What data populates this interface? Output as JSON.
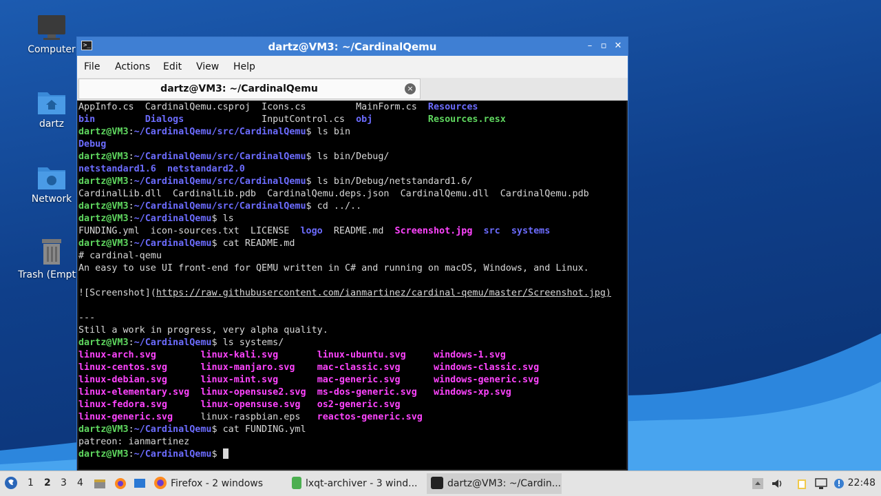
{
  "desktop": {
    "icons": [
      {
        "label": "Computer"
      },
      {
        "label": "dartz"
      },
      {
        "label": "Network"
      },
      {
        "label": "Trash (Empty)"
      }
    ]
  },
  "window": {
    "title": "dartz@VM3: ~/CardinalQemu",
    "controls": {
      "minimize": "–",
      "maximize": "▫",
      "close": "✕"
    },
    "menu": [
      "File",
      "Actions",
      "Edit",
      "View",
      "Help"
    ],
    "tab": {
      "label": "dartz@VM3: ~/CardinalQemu",
      "close": "×"
    }
  },
  "terminal": {
    "prompt_user": "dartz@VM3",
    "lines": [
      [
        {
          "t": "AppInfo.cs  CardinalQemu.csproj  Icons.cs         MainForm.cs  "
        },
        {
          "t": "Resources",
          "c": "d"
        }
      ],
      [
        {
          "t": "bin",
          "c": "d"
        },
        {
          "t": "         "
        },
        {
          "t": "Dialogs",
          "c": "d"
        },
        {
          "t": "              InputControl.cs  "
        },
        {
          "t": "obj",
          "c": "d"
        },
        {
          "t": "          "
        },
        {
          "t": "Resources.resx",
          "c": "g"
        }
      ],
      [
        {
          "t": "dartz@VM3",
          "c": "u"
        },
        {
          "t": ":"
        },
        {
          "t": "~/CardinalQemu/src/CardinalQemu",
          "c": "p"
        },
        {
          "t": "$ ls bin"
        }
      ],
      [
        {
          "t": "Debug",
          "c": "d"
        }
      ],
      [
        {
          "t": "dartz@VM3",
          "c": "u"
        },
        {
          "t": ":"
        },
        {
          "t": "~/CardinalQemu/src/CardinalQemu",
          "c": "p"
        },
        {
          "t": "$ ls bin/Debug/"
        }
      ],
      [
        {
          "t": "netstandard1.6",
          "c": "d"
        },
        {
          "t": "  "
        },
        {
          "t": "netstandard2.0",
          "c": "d"
        }
      ],
      [
        {
          "t": "dartz@VM3",
          "c": "u"
        },
        {
          "t": ":"
        },
        {
          "t": "~/CardinalQemu/src/CardinalQemu",
          "c": "p"
        },
        {
          "t": "$ ls bin/Debug/netstandard1.6/"
        }
      ],
      [
        {
          "t": "CardinalLib.dll  CardinalLib.pdb  CardinalQemu.deps.json  CardinalQemu.dll  CardinalQemu.pdb"
        }
      ],
      [
        {
          "t": "dartz@VM3",
          "c": "u"
        },
        {
          "t": ":"
        },
        {
          "t": "~/CardinalQemu/src/CardinalQemu",
          "c": "p"
        },
        {
          "t": "$ cd ../.."
        }
      ],
      [
        {
          "t": "dartz@VM3",
          "c": "u"
        },
        {
          "t": ":"
        },
        {
          "t": "~/CardinalQemu",
          "c": "p"
        },
        {
          "t": "$ ls"
        }
      ],
      [
        {
          "t": "FUNDING.yml  icon-sources.txt  LICENSE  "
        },
        {
          "t": "logo",
          "c": "d"
        },
        {
          "t": "  README.md  "
        },
        {
          "t": "Screenshot.jpg",
          "c": "m"
        },
        {
          "t": "  "
        },
        {
          "t": "src",
          "c": "d"
        },
        {
          "t": "  "
        },
        {
          "t": "systems",
          "c": "d"
        }
      ],
      [
        {
          "t": "dartz@VM3",
          "c": "u"
        },
        {
          "t": ":"
        },
        {
          "t": "~/CardinalQemu",
          "c": "p"
        },
        {
          "t": "$ cat README.md"
        }
      ],
      [
        {
          "t": "# cardinal-qemu"
        }
      ],
      [
        {
          "t": "An easy to use UI front-end for QEMU written in C# and running on macOS, Windows, and Linux."
        }
      ],
      [
        {
          "t": ""
        }
      ],
      [
        {
          "t": "![Screenshot]("
        },
        {
          "t": "https://raw.githubusercontent.com/ianmartinez/cardinal-qemu/master/Screenshot.jpg)",
          "c": "lk"
        }
      ],
      [
        {
          "t": ""
        }
      ],
      [
        {
          "t": "---"
        }
      ],
      [
        {
          "t": "Still a work in progress, very alpha quality."
        }
      ],
      [
        {
          "t": "dartz@VM3",
          "c": "u"
        },
        {
          "t": ":"
        },
        {
          "t": "~/CardinalQemu",
          "c": "p"
        },
        {
          "t": "$ ls systems/"
        }
      ],
      [
        {
          "t": "linux-arch.svg",
          "c": "m"
        },
        {
          "t": "        "
        },
        {
          "t": "linux-kali.svg",
          "c": "m"
        },
        {
          "t": "       "
        },
        {
          "t": "linux-ubuntu.svg",
          "c": "m"
        },
        {
          "t": "     "
        },
        {
          "t": "windows-1.svg",
          "c": "m"
        }
      ],
      [
        {
          "t": "linux-centos.svg",
          "c": "m"
        },
        {
          "t": "      "
        },
        {
          "t": "linux-manjaro.svg",
          "c": "m"
        },
        {
          "t": "    "
        },
        {
          "t": "mac-classic.svg",
          "c": "m"
        },
        {
          "t": "      "
        },
        {
          "t": "windows-classic.svg",
          "c": "m"
        }
      ],
      [
        {
          "t": "linux-debian.svg",
          "c": "m"
        },
        {
          "t": "      "
        },
        {
          "t": "linux-mint.svg",
          "c": "m"
        },
        {
          "t": "       "
        },
        {
          "t": "mac-generic.svg",
          "c": "m"
        },
        {
          "t": "      "
        },
        {
          "t": "windows-generic.svg",
          "c": "m"
        }
      ],
      [
        {
          "t": "linux-elementary.svg",
          "c": "m"
        },
        {
          "t": "  "
        },
        {
          "t": "linux-opensuse2.svg",
          "c": "m"
        },
        {
          "t": "  "
        },
        {
          "t": "ms-dos-generic.svg",
          "c": "m"
        },
        {
          "t": "   "
        },
        {
          "t": "windows-xp.svg",
          "c": "m"
        }
      ],
      [
        {
          "t": "linux-fedora.svg",
          "c": "m"
        },
        {
          "t": "      "
        },
        {
          "t": "linux-opensuse.svg",
          "c": "m"
        },
        {
          "t": "   "
        },
        {
          "t": "os2-generic.svg",
          "c": "m"
        }
      ],
      [
        {
          "t": "linux-generic.svg",
          "c": "m"
        },
        {
          "t": "     linux-raspbian.eps   "
        },
        {
          "t": "reactos-generic.svg",
          "c": "m"
        }
      ],
      [
        {
          "t": "dartz@VM3",
          "c": "u"
        },
        {
          "t": ":"
        },
        {
          "t": "~/CardinalQemu",
          "c": "p"
        },
        {
          "t": "$ cat FUNDING.yml"
        }
      ],
      [
        {
          "t": "patreon: ianmartinez"
        }
      ],
      [
        {
          "t": "dartz@VM3",
          "c": "u"
        },
        {
          "t": ":"
        },
        {
          "t": "~/CardinalQemu",
          "c": "p"
        },
        {
          "t": "$ "
        },
        {
          "t": "",
          "c": "cursor"
        }
      ]
    ]
  },
  "taskbar": {
    "workspaces": [
      "1",
      "2",
      "3",
      "4"
    ],
    "active_workspace": "2",
    "tasks": [
      {
        "label": "Firefox - 2 windows",
        "icon": "firefox-icon"
      },
      {
        "label": "lxqt-archiver - 3 wind...",
        "icon": "archiver-icon"
      },
      {
        "label": "dartz@VM3: ~/Cardin...",
        "icon": "terminal-icon"
      }
    ],
    "clock": "22:48",
    "colors": {
      "accent": "#3f7fd3",
      "desktop": "#1c5bb0"
    }
  }
}
